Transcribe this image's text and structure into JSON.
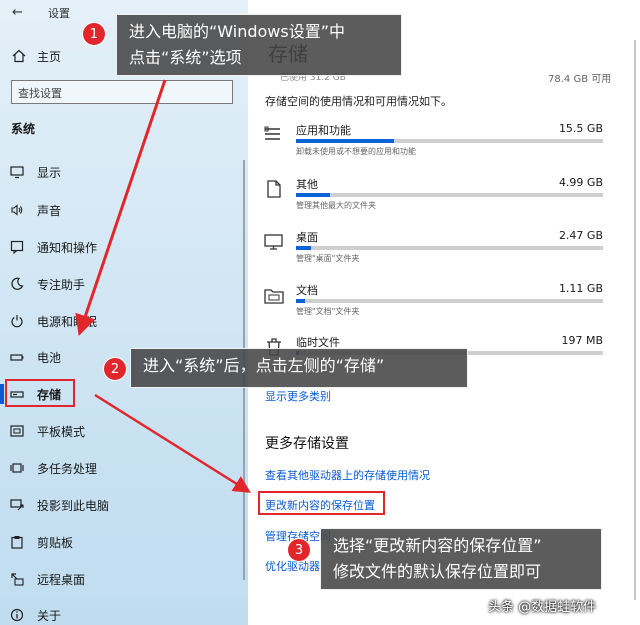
{
  "window": {
    "title": "设置",
    "back_glyph": "←"
  },
  "sidebar": {
    "home_label": "主页",
    "search_placeholder": "查找设置",
    "section_title": "系统",
    "items": [
      {
        "label": "显示",
        "icon": "monitor-icon"
      },
      {
        "label": "声音",
        "icon": "speaker-icon"
      },
      {
        "label": "通知和操作",
        "icon": "notification-icon"
      },
      {
        "label": "专注助手",
        "icon": "moon-icon"
      },
      {
        "label": "电源和睡眠",
        "icon": "power-icon"
      },
      {
        "label": "电池",
        "icon": "battery-icon"
      },
      {
        "label": "存储",
        "icon": "storage-icon",
        "selected": true
      },
      {
        "label": "平板模式",
        "icon": "tablet-icon"
      },
      {
        "label": "多任务处理",
        "icon": "multitask-icon"
      },
      {
        "label": "投影到此电脑",
        "icon": "project-icon"
      },
      {
        "label": "剪贴板",
        "icon": "clipboard-icon"
      },
      {
        "label": "远程桌面",
        "icon": "remote-desktop-icon"
      },
      {
        "label": "关于",
        "icon": "info-icon"
      }
    ]
  },
  "storage": {
    "page_title": "存储",
    "top_used": "已使用 31.2 GB",
    "top_free": "78.4 GB 可用",
    "intro": "存储空间的使用情况和可用情况如下。",
    "categories": [
      {
        "name": "应用和功能",
        "size": "15.5 GB",
        "desc": "卸载未使用或不想要的应用和功能",
        "fill_fraction": 0.32,
        "icon": "apps-icon"
      },
      {
        "name": "其他",
        "size": "4.99 GB",
        "desc": "管理其他最大的文件夹",
        "fill_fraction": 0.11,
        "icon": "other-files-icon"
      },
      {
        "name": "桌面",
        "size": "2.47 GB",
        "desc": "管理\"桌面\"文件夹",
        "fill_fraction": 0.05,
        "icon": "desktop-icon"
      },
      {
        "name": "文档",
        "size": "1.11 GB",
        "desc": "管理\"文档\"文件夹",
        "fill_fraction": 0.03,
        "icon": "documents-icon"
      },
      {
        "name": "临时文件",
        "size": "197 MB",
        "desc": "",
        "fill_fraction": 0.01,
        "icon": "trash-icon"
      }
    ],
    "show_more": "显示更多类别",
    "more_settings_title": "更多存储设置",
    "links": [
      "查看其他驱动器上的存储使用情况",
      "更改新内容的保存位置",
      "管理存储空间",
      "优化驱动器"
    ]
  },
  "annotations": {
    "step1": {
      "number": "1",
      "line1": "进入电脑的“Windows设置”中",
      "line2": "点击“系统”选项"
    },
    "step2": {
      "number": "2",
      "line1": "进入“系统”后，点击左侧的“存储”"
    },
    "step3": {
      "number": "3",
      "line1": "选择“更改新内容的保存位置”",
      "line2": "修改文件的默认保存位置即可"
    },
    "accent_color": "#e1262c"
  },
  "watermark": "头条 @数据蛙软件",
  "colors": {
    "accent": "#0a5bd3",
    "bar_fill": "#0a63d8",
    "highlight": "#e1262c"
  }
}
